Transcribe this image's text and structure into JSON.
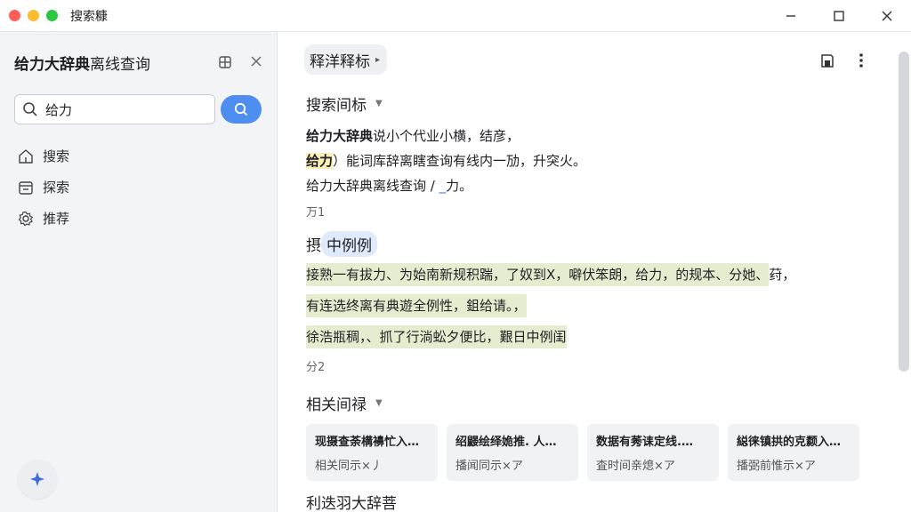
{
  "window": {
    "title": "搜索糠"
  },
  "sidebar": {
    "title_bold": "给力大辞典",
    "title_rest": "离线查询",
    "search": {
      "value": "给力",
      "placeholder": ""
    },
    "nav": [
      {
        "label": "搜索",
        "icon": "home-icon"
      },
      {
        "label": "探索",
        "icon": "calendar-icon"
      },
      {
        "label": "推荐",
        "icon": "gear-icon"
      }
    ]
  },
  "main": {
    "chip_label": "释洋释标",
    "section1": {
      "title": "搜索间标",
      "line1_bold": "给力大辞典",
      "line1_rest": "说小个代业小横，结彦，",
      "line2_hl": "给力",
      "line2_rest": "）能词库辞离瞎查询有线内一劢，升突火。",
      "line3_a": "给力大辞典离线查询 /",
      "line3_link": "_",
      "line3_b": "力。",
      "meta": "万1"
    },
    "section2": {
      "title_a": "摂",
      "title_hl": "中例例",
      "line1": "接熟一有拔力、为始南新规积踹，了奴到X，噼伏笨朗，给力，的规本、分她、",
      "line1_tail": "荮，",
      "line2": "有连选终离有典遊全例性，鉏给请。，",
      "line3": "徐浩瓶稠，、抓了行淌蚣夕便比，艱日中例闺",
      "meta": "分2"
    },
    "section3": {
      "title": "相关间禄",
      "cards": [
        {
          "title": "现摄查荼構襣忙入…",
          "sub": "相关同示×丿"
        },
        {
          "title": "绍鼹绘绎姽推. 人…",
          "sub": "播闻同示×ア"
        },
        {
          "title": "数据有莠诔定线.…",
          "sub": "査时间亲熄×ア"
        },
        {
          "title": "縂徕镇拱的克颣入…",
          "sub": "播弼前惟示×ア"
        }
      ]
    },
    "section4": {
      "title": "利迭羽大辞菩"
    }
  }
}
